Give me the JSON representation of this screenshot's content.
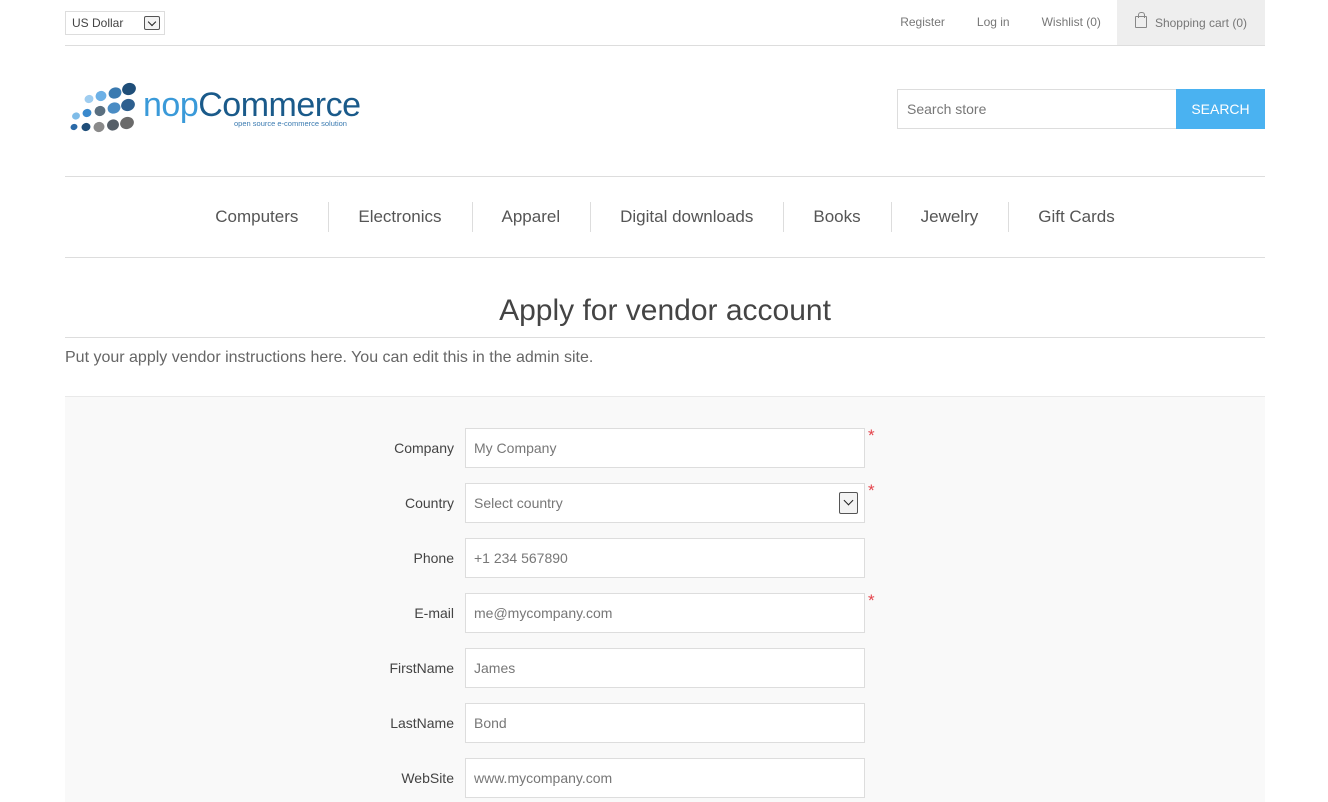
{
  "header": {
    "currency": "US Dollar",
    "links": {
      "register": "Register",
      "login": "Log in",
      "wishlist": "Wishlist (0)",
      "cart": "Shopping cart (0)"
    }
  },
  "logo": {
    "prefix": "nop",
    "name": "Commerce",
    "tagline": "open source e-commerce solution"
  },
  "search": {
    "placeholder": "Search store",
    "button": "SEARCH"
  },
  "menu": [
    "Computers",
    "Electronics",
    "Apparel",
    "Digital downloads",
    "Books",
    "Jewelry",
    "Gift Cards"
  ],
  "page": {
    "title": "Apply for vendor account",
    "instructions": "Put your apply vendor instructions here. You can edit this in the admin site."
  },
  "form": {
    "required_mark": "*",
    "fields": [
      {
        "label": "Company",
        "value": "My Company",
        "required": true
      },
      {
        "label": "Country",
        "value": "Select country",
        "required": true
      },
      {
        "label": "Phone",
        "value": "+1 234 567890",
        "required": false
      },
      {
        "label": "E-mail",
        "value": "me@mycompany.com",
        "required": true
      },
      {
        "label": "FirstName",
        "value": "James",
        "required": false
      },
      {
        "label": "LastName",
        "value": "Bond",
        "required": false
      },
      {
        "label": "WebSite",
        "value": "www.mycompany.com",
        "required": false
      }
    ]
  },
  "colors": {
    "accent": "#4ab2f1",
    "required": "#e4434b",
    "form_bg": "#f9f9f9"
  }
}
